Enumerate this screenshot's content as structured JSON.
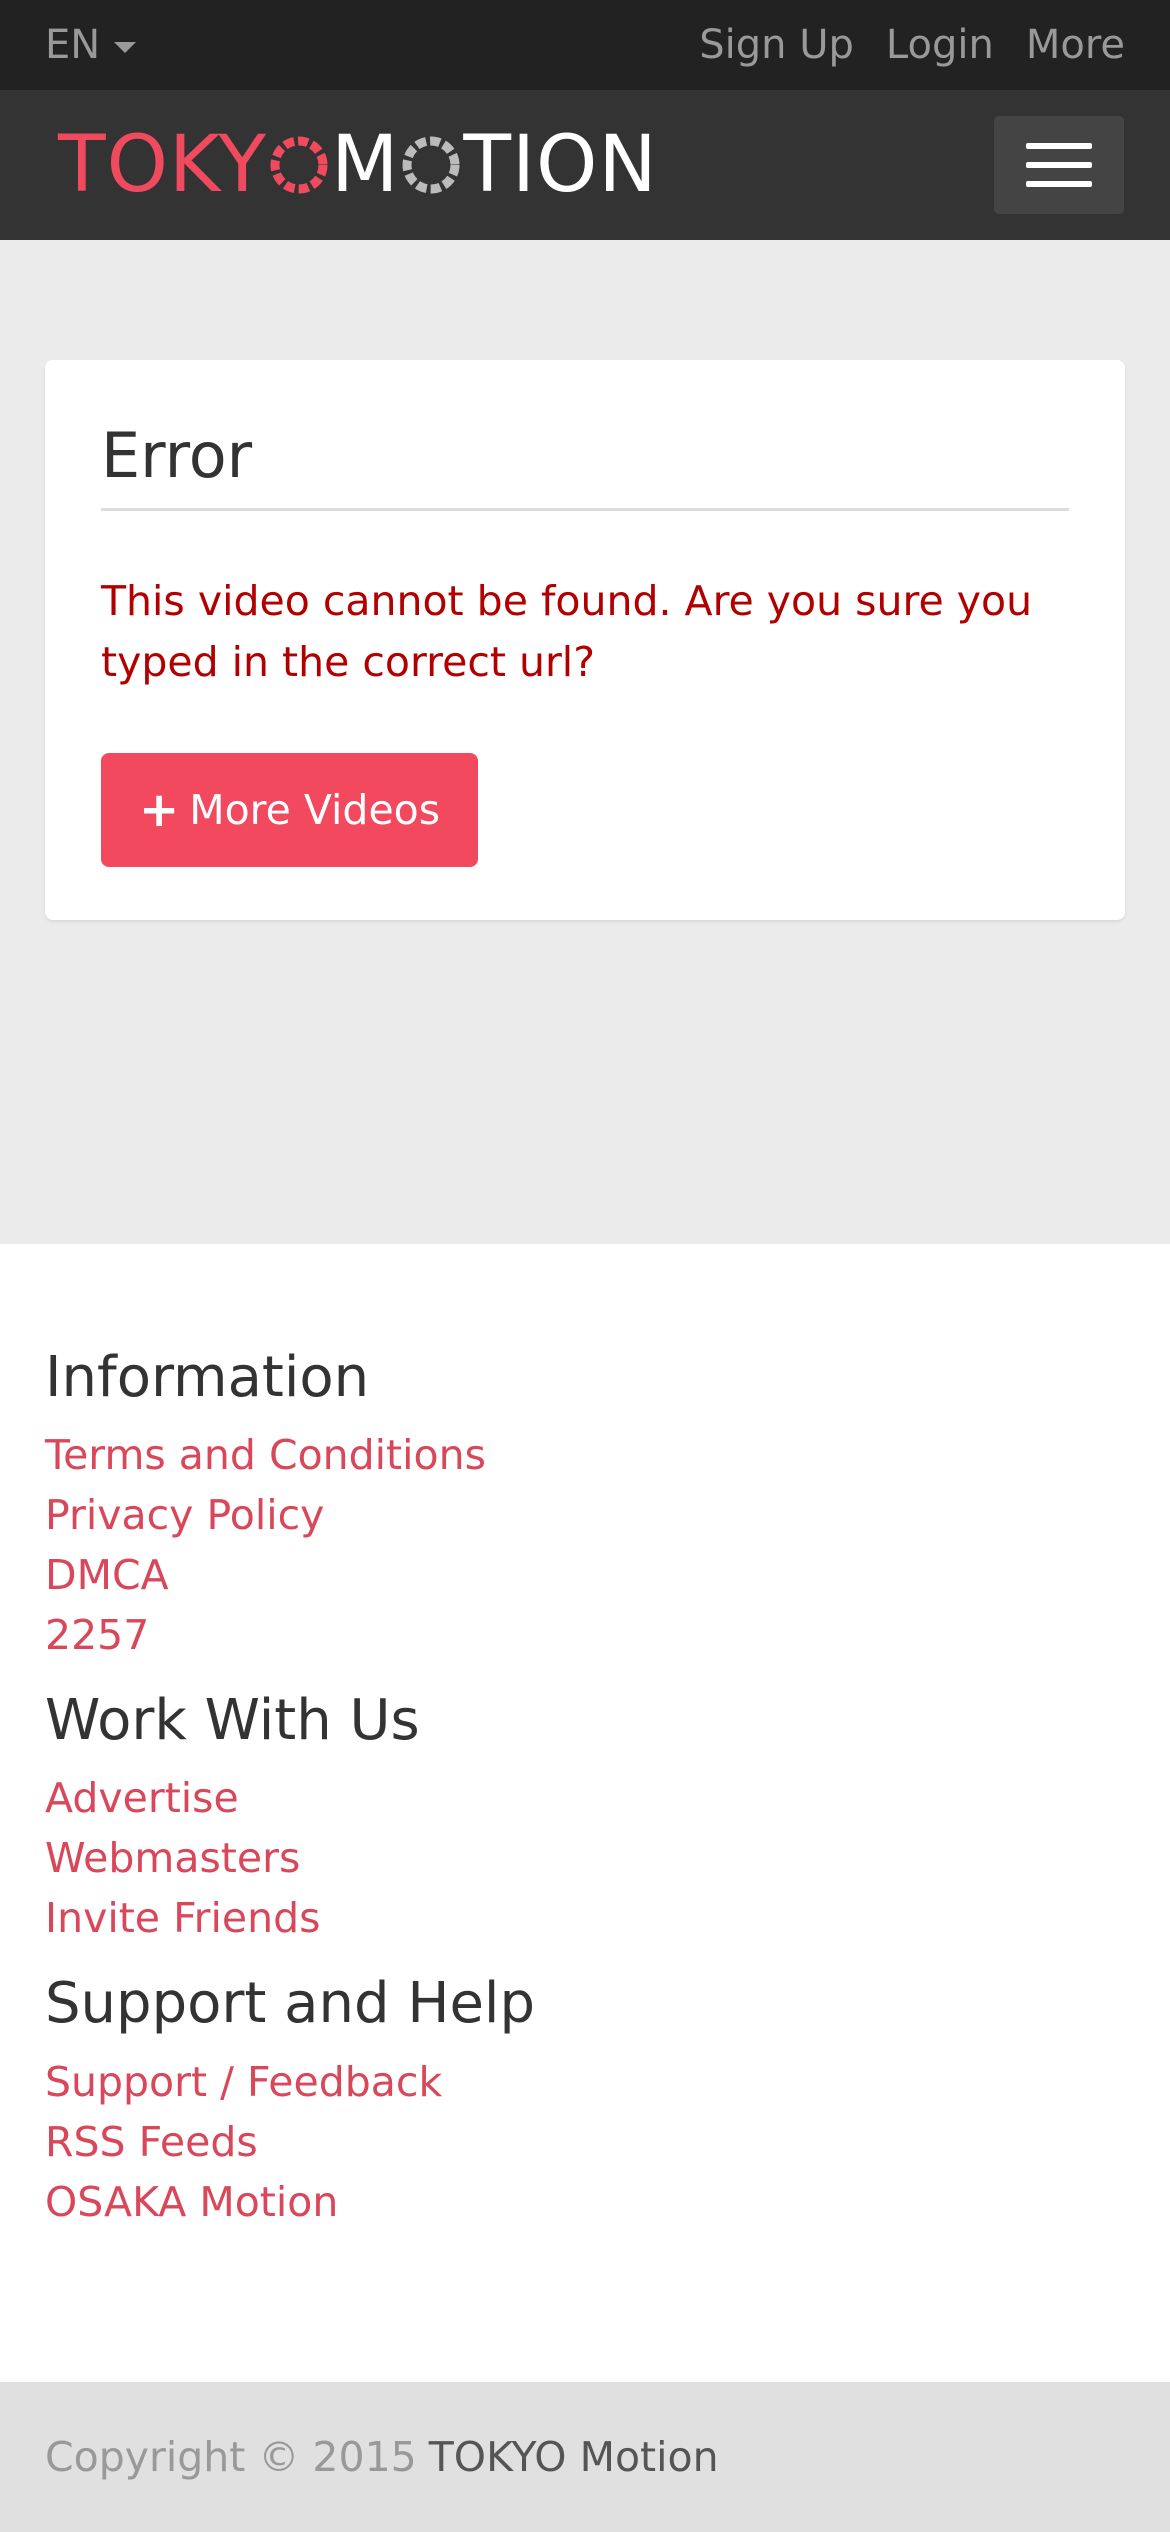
{
  "topbar": {
    "language": "EN",
    "links": [
      "Sign Up",
      "Login",
      "More"
    ]
  },
  "header": {
    "logo_part1": "TOKY",
    "logo_part2": "M",
    "logo_part3": "TION",
    "logo_accent_color": "#f04a5e"
  },
  "error": {
    "title": "Error",
    "message": "This video cannot be found. Are you sure you typed in the correct url?",
    "button_label": "More Videos",
    "button_icon": "plus-icon"
  },
  "footer": {
    "sections": [
      {
        "title": "Information",
        "links": [
          "Terms and Conditions",
          "Privacy Policy",
          "DMCA",
          "2257"
        ]
      },
      {
        "title": "Work With Us",
        "links": [
          "Advertise",
          "Webmasters",
          "Invite Friends"
        ]
      },
      {
        "title": "Support and Help",
        "links": [
          "Support / Feedback",
          "RSS Feeds",
          "OSAKA Motion"
        ]
      }
    ]
  },
  "copyright": {
    "prefix": "Copyright © 2015",
    "brand": "TOKYO Motion"
  }
}
